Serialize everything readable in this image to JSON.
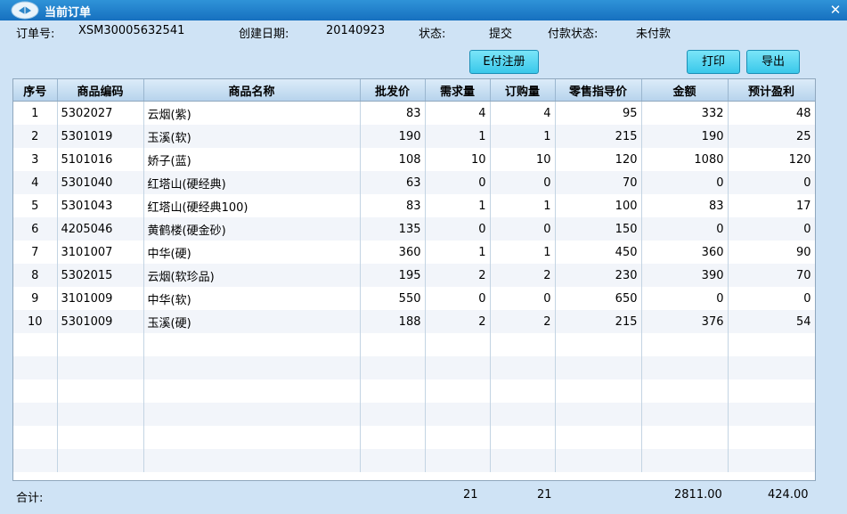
{
  "window": {
    "title": "当前订单",
    "icon": "app-logo-icon",
    "close_label": "✕"
  },
  "order": {
    "no_label": "订单号:",
    "no_value": "XSM30005632541",
    "date_label": "创建日期:",
    "date_value": "20140923",
    "status_label": "状态:",
    "status_value": "提交",
    "pay_label": "付款状态:",
    "pay_value": "未付款"
  },
  "buttons": {
    "epay": "E付注册",
    "print": "打印",
    "export": "导出"
  },
  "columns": [
    "序号",
    "商品编码",
    "商品名称",
    "批发价",
    "需求量",
    "订购量",
    "零售指导价",
    "金额",
    "预计盈利"
  ],
  "rows": [
    [
      "1",
      "5302027",
      "云烟(紫)",
      "83",
      "4",
      "4",
      "95",
      "332",
      "48"
    ],
    [
      "2",
      "5301019",
      "玉溪(软)",
      "190",
      "1",
      "1",
      "215",
      "190",
      "25"
    ],
    [
      "3",
      "5101016",
      "娇子(蓝)",
      "108",
      "10",
      "10",
      "120",
      "1080",
      "120"
    ],
    [
      "4",
      "5301040",
      "红塔山(硬经典)",
      "63",
      "0",
      "0",
      "70",
      "0",
      "0"
    ],
    [
      "5",
      "5301043",
      "红塔山(硬经典100)",
      "83",
      "1",
      "1",
      "100",
      "83",
      "17"
    ],
    [
      "6",
      "4205046",
      "黄鹤楼(硬金砂)",
      "135",
      "0",
      "0",
      "150",
      "0",
      "0"
    ],
    [
      "7",
      "3101007",
      "中华(硬)",
      "360",
      "1",
      "1",
      "450",
      "360",
      "90"
    ],
    [
      "8",
      "5302015",
      "云烟(软珍品)",
      "195",
      "2",
      "2",
      "230",
      "390",
      "70"
    ],
    [
      "9",
      "3101009",
      "中华(软)",
      "550",
      "0",
      "0",
      "650",
      "0",
      "0"
    ],
    [
      "10",
      "5301009",
      "玉溪(硬)",
      "188",
      "2",
      "2",
      "215",
      "376",
      "54"
    ]
  ],
  "totals": {
    "label": "合计:",
    "demand": "21",
    "ordered": "21",
    "amount": "2811.00",
    "profit": "424.00"
  },
  "colors": {
    "titlebar": "#1670bf",
    "background": "#cfe3f5",
    "button": "#39c8ea"
  }
}
